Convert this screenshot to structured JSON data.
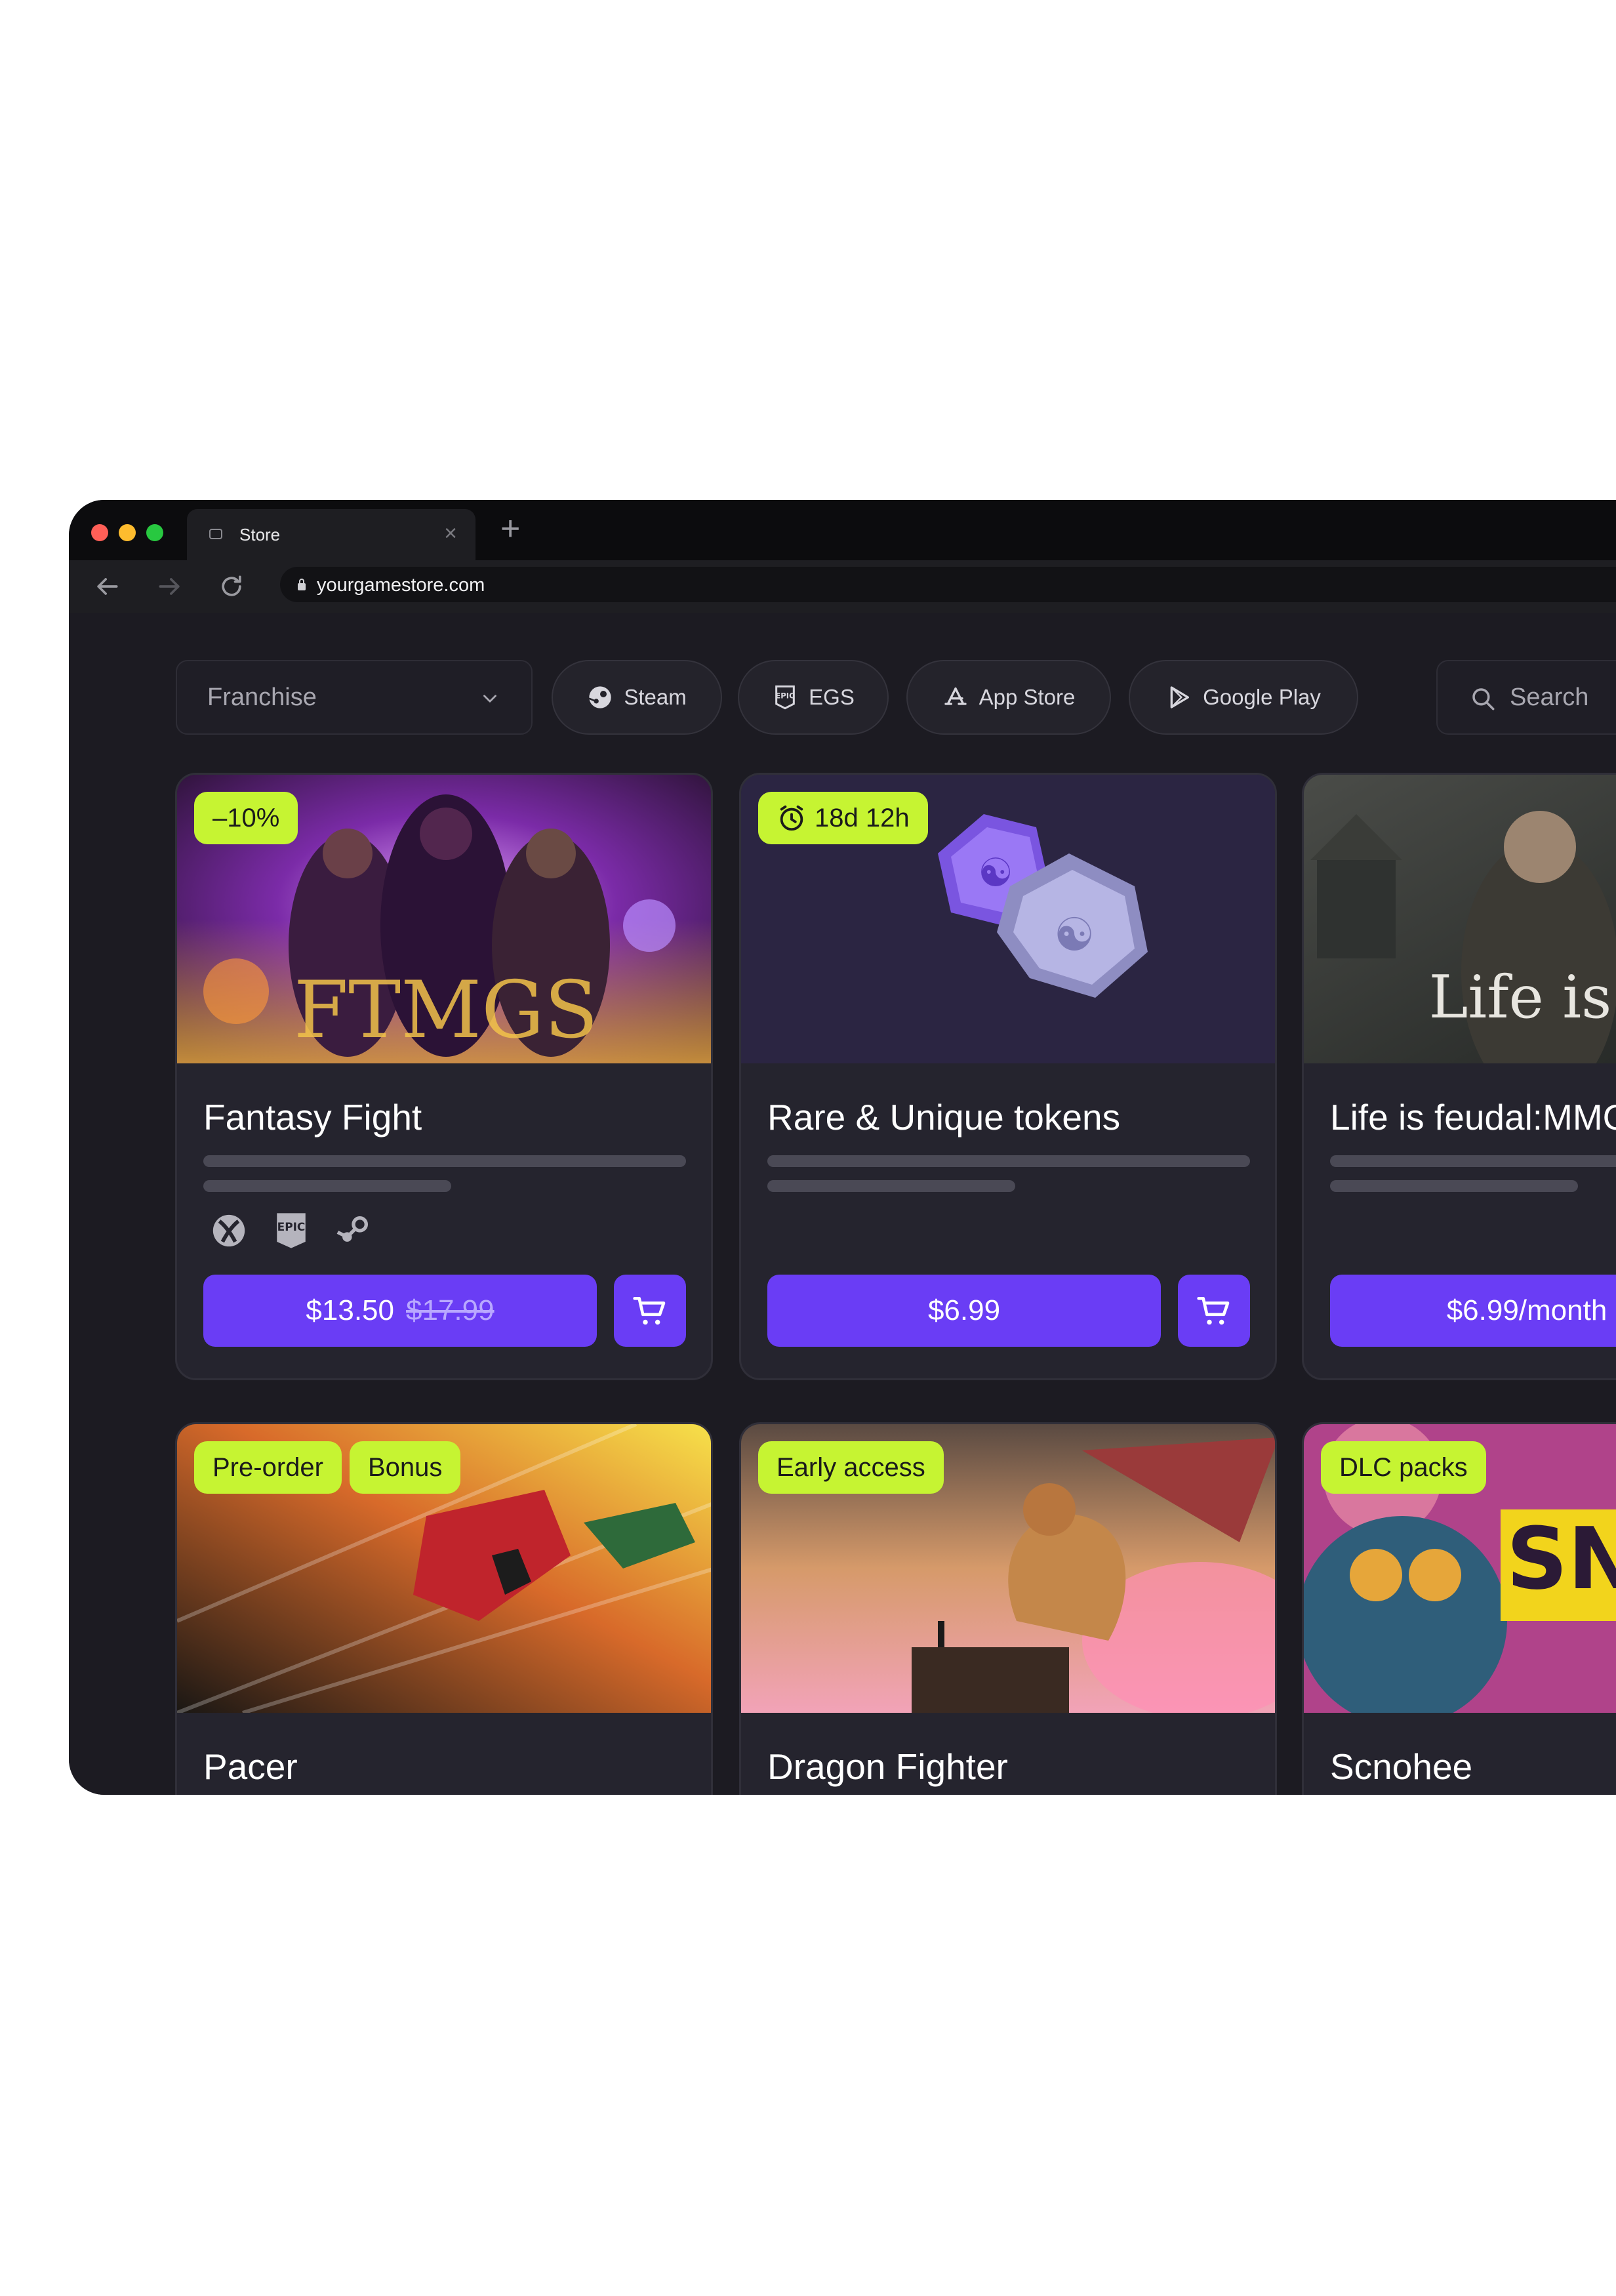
{
  "browser": {
    "tab_title": "Store",
    "tab_close": "×",
    "new_tab": "+",
    "url": "yourgamestore.com"
  },
  "filters": {
    "franchise_label": "Franchise",
    "platforms": [
      {
        "label": "Steam",
        "icon": "steam-icon"
      },
      {
        "label": "EGS",
        "icon": "epic-games-icon"
      },
      {
        "label": "App Store",
        "icon": "app-store-icon"
      },
      {
        "label": "Google Play",
        "icon": "google-play-icon"
      }
    ],
    "search_placeholder": "Search"
  },
  "colors": {
    "accent": "#6a3df5",
    "badge": "#c6f432",
    "background": "#1c1b22",
    "card": "#25242e"
  },
  "cards": [
    {
      "title": "Fantasy Fight",
      "badges": [
        "–10%"
      ],
      "platform_icons": [
        "xbox-icon",
        "epic-games-icon",
        "steam-icon"
      ],
      "price": "$13.50",
      "old_price": "$17.99"
    },
    {
      "title": "Rare & Unique tokens",
      "badges": [
        "18d 12h"
      ],
      "badge_icon": "alarm-clock-icon",
      "price": "$6.99"
    },
    {
      "title": "Life is feudal:MMO",
      "price": "$6.99/month"
    },
    {
      "title": "Pacer",
      "badges": [
        "Pre-order",
        "Bonus"
      ]
    },
    {
      "title": "Dragon Fighter",
      "badges": [
        "Early access"
      ]
    },
    {
      "title": "Scnohee",
      "badges": [
        "DLC packs"
      ]
    }
  ]
}
